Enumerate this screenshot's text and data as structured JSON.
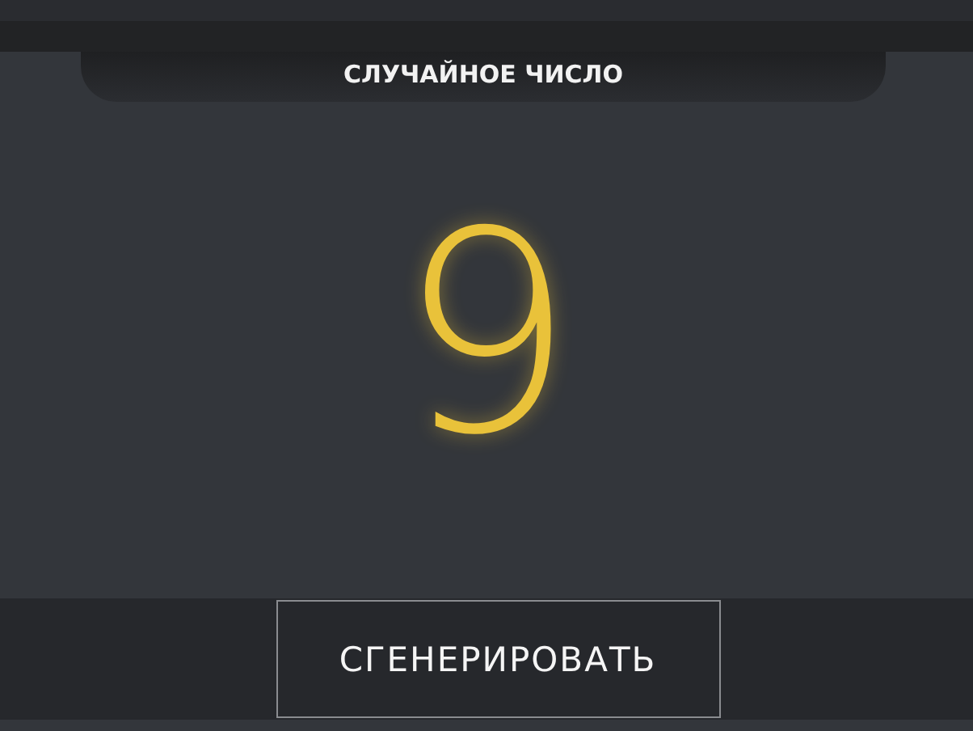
{
  "title": "СЛУЧАЙНОЕ ЧИСЛО",
  "result": "9",
  "buttons": [
    "СГЕНЕРИРОВАТЬ"
  ]
}
